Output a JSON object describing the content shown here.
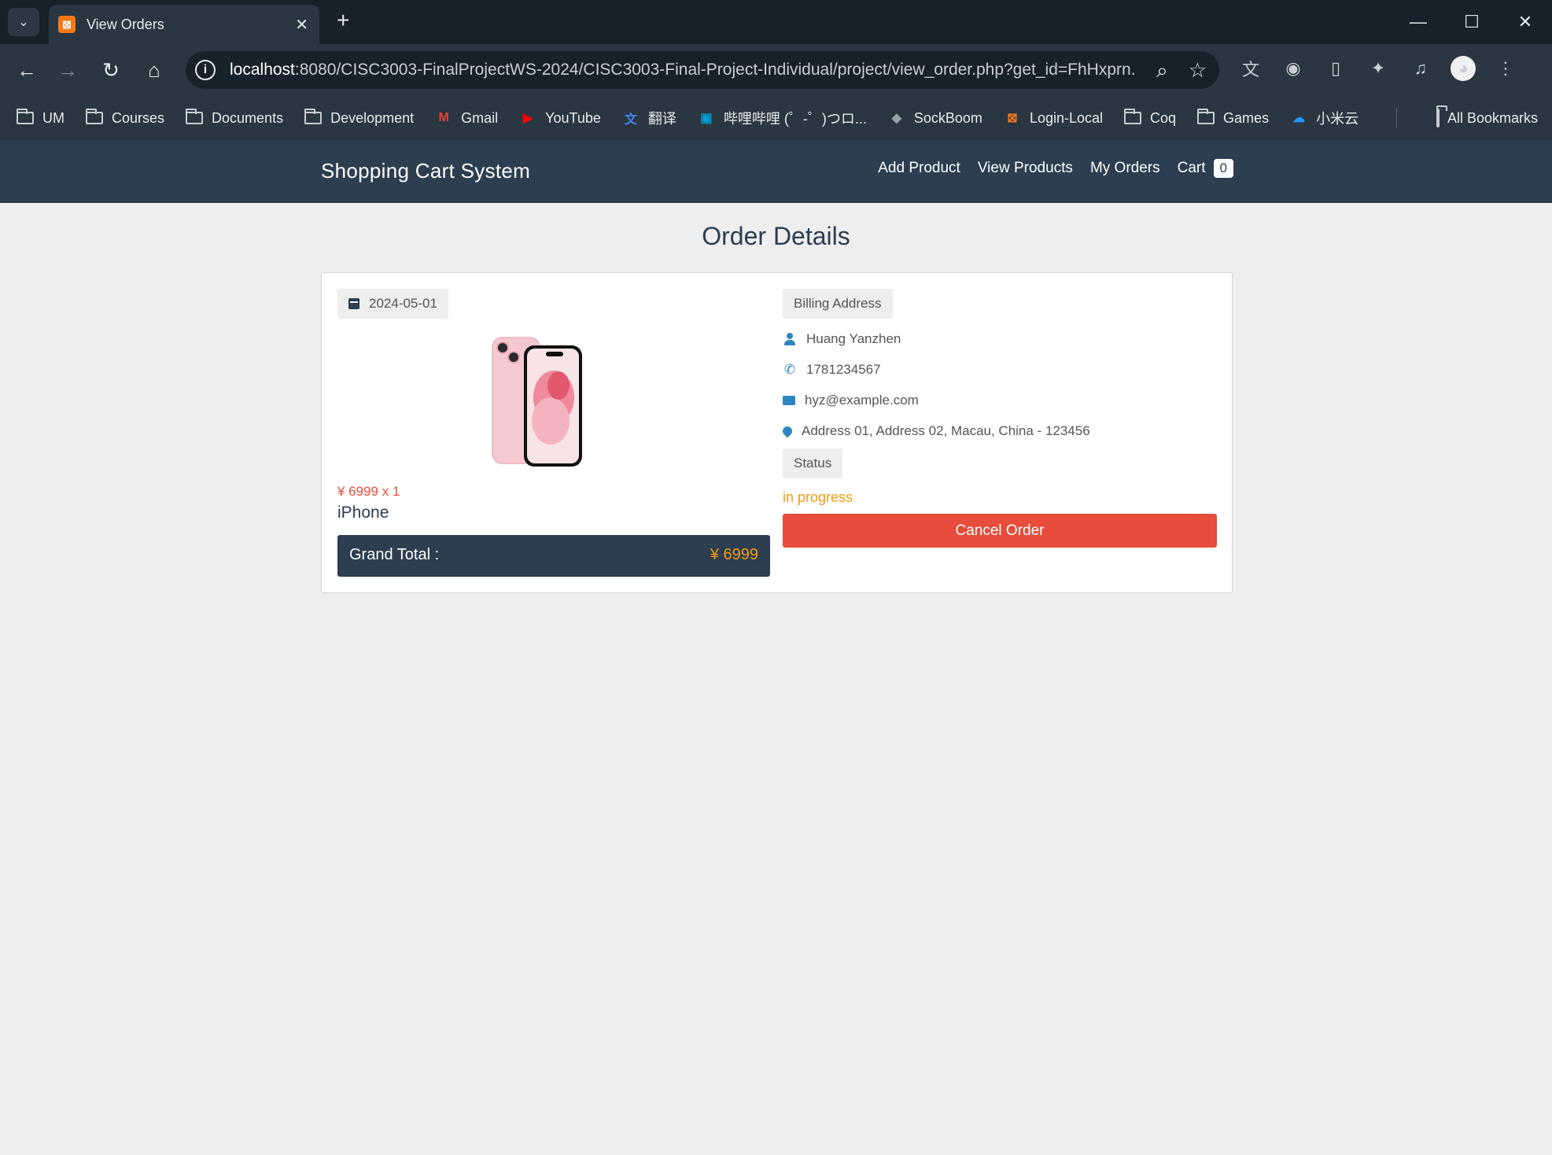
{
  "browser": {
    "tab_title": "View Orders",
    "url_host": "localhost",
    "url_path": ":8080/CISC3003-FinalProjectWS-2024/CISC3003-Final-Project-Individual/project/view_order.php?get_id=FhHxprn...",
    "bookmarks": [
      {
        "label": "UM",
        "icon": "folder-icon"
      },
      {
        "label": "Courses",
        "icon": "folder-icon"
      },
      {
        "label": "Documents",
        "icon": "folder-icon"
      },
      {
        "label": "Development",
        "icon": "folder-icon"
      },
      {
        "label": "Gmail",
        "icon": "gmail-icon"
      },
      {
        "label": "YouTube",
        "icon": "youtube-icon"
      },
      {
        "label": "翻译",
        "icon": "translate-icon"
      },
      {
        "label": "哔哩哔哩 (゜-゜)つロ...",
        "icon": "bilibili-icon"
      },
      {
        "label": "SockBoom",
        "icon": "sockboom-icon"
      },
      {
        "label": "Login-Local",
        "icon": "xampp-icon"
      },
      {
        "label": "Coq",
        "icon": "folder-icon"
      },
      {
        "label": "Games",
        "icon": "folder-icon"
      },
      {
        "label": "小米云",
        "icon": "xiaomi-cloud-icon"
      }
    ],
    "all_bookmarks": "All Bookmarks"
  },
  "navbar": {
    "brand": "Shopping Cart System",
    "links": {
      "add_product": "Add Product",
      "view_products": "View Products",
      "my_orders": "My Orders",
      "cart": "Cart",
      "cart_count": "0"
    }
  },
  "page_title": "Order Details",
  "order": {
    "date": "2024-05-01",
    "price_line": "¥ 6999 x 1",
    "product_name": "iPhone",
    "grand_total_label": "Grand Total :",
    "grand_total_value": "¥ 6999",
    "billing_label": "Billing Address",
    "name": "Huang Yanzhen",
    "phone": "1781234567",
    "email": "hyz@example.com",
    "address": "Address 01, Address 02, Macau, China - 123456",
    "status_label": "Status",
    "status_value": "in progress",
    "cancel_label": "Cancel Order"
  },
  "colors": {
    "navbar": "#2c3e50",
    "accent_orange": "#f39c12",
    "danger": "#e74c3c",
    "icon_blue": "#2e86c1"
  }
}
